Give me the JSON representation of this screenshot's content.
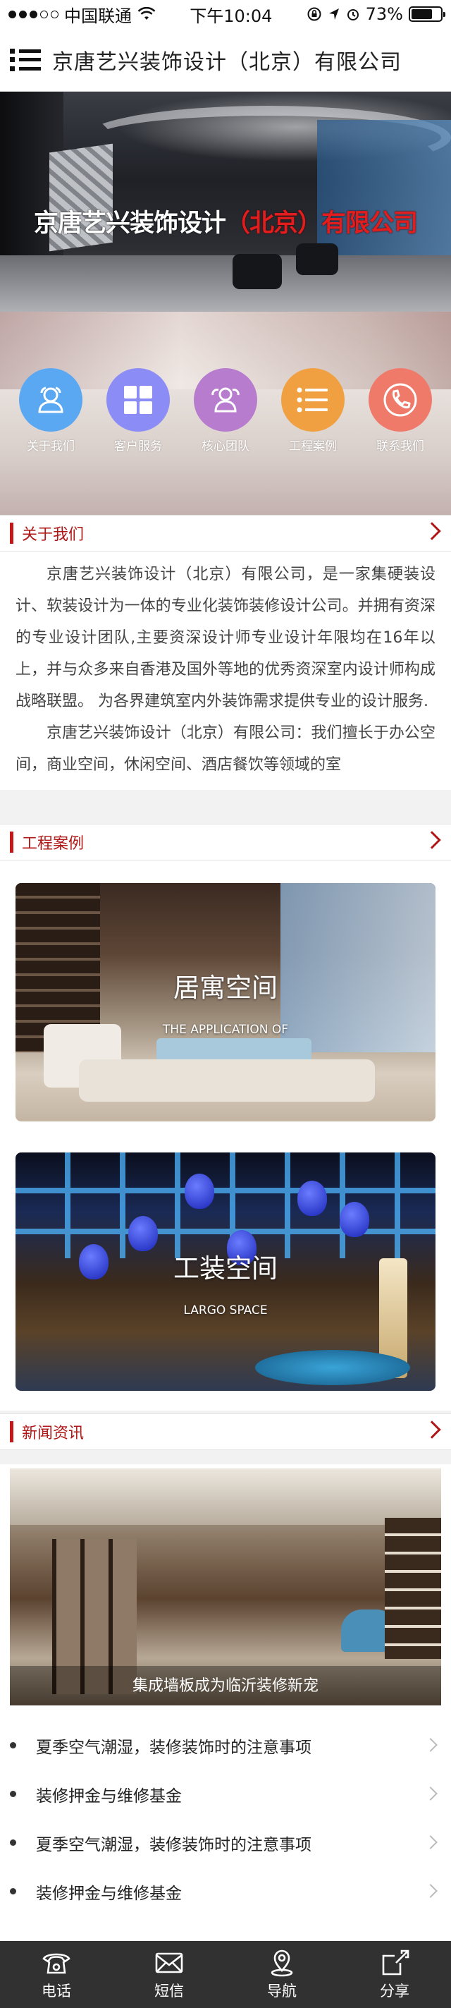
{
  "status_bar": {
    "carrier": "中国联通",
    "time": "下午10:04",
    "battery": "73%",
    "battery_level": 0.73,
    "signal_bars_filled": 3,
    "signal_bars_total": 5
  },
  "header": {
    "title": "京唐艺兴装饰设计（北京）有限公司"
  },
  "hero": {
    "caption_white_1": "京唐艺兴装饰设计",
    "caption_red_1": "（北京）",
    "caption_white_2": "有限公司"
  },
  "icon_nav": {
    "items": [
      {
        "label": "关于我们",
        "icon": "users-icon",
        "color": "#5ba8f2"
      },
      {
        "label": "客户服务",
        "icon": "grid-icon",
        "color": "#8b8cf5"
      },
      {
        "label": "核心团队",
        "icon": "team-icon",
        "color": "#b87ccf"
      },
      {
        "label": "工程案例",
        "icon": "list-icon",
        "color": "#f0a040"
      },
      {
        "label": "联系我们",
        "icon": "phone-icon",
        "color": "#f07a6a"
      }
    ]
  },
  "about": {
    "heading": "关于我们",
    "paragraph_1": "京唐艺兴装饰设计（北京）有限公司，是一家集硬装设计、软装设计为一体的专业化装饰装修设计公司。并拥有资深的专业设计团队,主要资深设计师专业设计年限均在16年以上，并与众多来自香港及国外等地的优秀资深室内设计师构成战略联盟。 为各界建筑室内外装饰需求提供专业的设计服务.",
    "paragraph_2": "京唐艺兴装饰设计（北京）有限公司：我们擅长于办公空间，商业空间，休闲空间、酒店餐饮等领域的室"
  },
  "cases": {
    "heading": "工程案例",
    "items": [
      {
        "title": "居寓空间",
        "subtitle": "THE APPLICATION OF"
      },
      {
        "title": "工装空间",
        "subtitle": "LARGO SPACE"
      }
    ]
  },
  "news": {
    "heading": "新闻资讯",
    "featured_caption": "集成墙板成为临沂装修新宠",
    "items": [
      "夏季空气潮湿，装修装饰时的注意事项",
      "装修押金与维修基金",
      "夏季空气潮湿，装修装饰时的注意事项",
      "装修押金与维修基金"
    ]
  },
  "bottom_nav": {
    "items": [
      {
        "label": "电话",
        "icon": "telephone-icon"
      },
      {
        "label": "短信",
        "icon": "envelope-icon"
      },
      {
        "label": "导航",
        "icon": "location-pin-icon"
      },
      {
        "label": "分享",
        "icon": "share-icon"
      }
    ]
  },
  "colors": {
    "accent_red": "#c41818",
    "bottom_bar": "#313131"
  }
}
